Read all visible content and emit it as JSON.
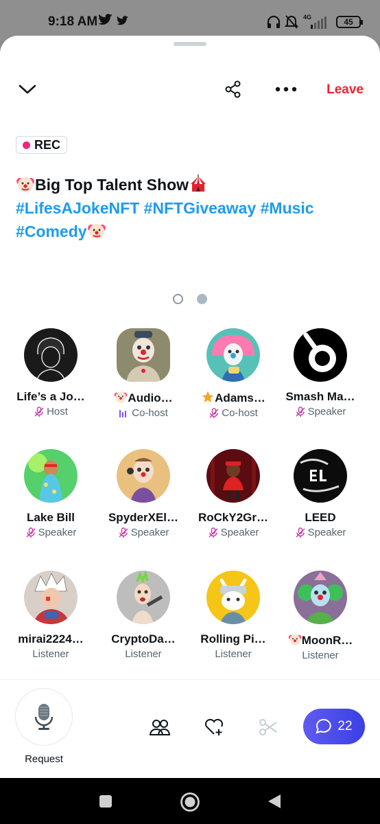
{
  "status_bar": {
    "time": "9:18 AM",
    "battery": "45",
    "network": "4G"
  },
  "header": {
    "leave_label": "Leave"
  },
  "space": {
    "rec_label": "REC",
    "title": "Big Top Talent Show",
    "hashtags_line1": "#LifesAJokeNFT #NFTGiveaway #Music",
    "hashtags_line2": "#Comedy"
  },
  "participants": [
    {
      "name": "Life’s a Jo…",
      "role": "Host",
      "role_icon": "mic-off-icon"
    },
    {
      "name": "Audio…",
      "role": "Co-host",
      "role_icon": "audio-bars-icon",
      "prefix_emoji": "clown"
    },
    {
      "name": "Adams…",
      "role": "Co-host",
      "role_icon": "mic-off-icon",
      "prefix_emoji": "star"
    },
    {
      "name": "Smash Ma…",
      "role": "Speaker",
      "role_icon": "mic-off-icon"
    },
    {
      "name": "Lake Bill",
      "role": "Speaker",
      "role_icon": "mic-off-icon"
    },
    {
      "name": "SpyderXEl…",
      "role": "Speaker",
      "role_icon": "mic-off-icon"
    },
    {
      "name": "RoCkY2Gr…",
      "role": "Speaker",
      "role_icon": "mic-off-icon"
    },
    {
      "name": "LEED",
      "role": "Speaker",
      "role_icon": "mic-off-icon"
    },
    {
      "name": "mirai2224…",
      "role": "Listener"
    },
    {
      "name": "CryptoDa…",
      "role": "Listener"
    },
    {
      "name": "Rolling Pi…",
      "role": "Listener"
    },
    {
      "name": "MoonR…",
      "role": "Listener",
      "prefix_emoji": "clown"
    }
  ],
  "bottom_bar": {
    "request_label": "Request",
    "comments_count": "22"
  },
  "colors": {
    "accent_red": "#f4212e",
    "link_blue": "#1d9bf0",
    "role_purple": "#7c4dff",
    "chat_gradient": "#5f5bf0"
  }
}
